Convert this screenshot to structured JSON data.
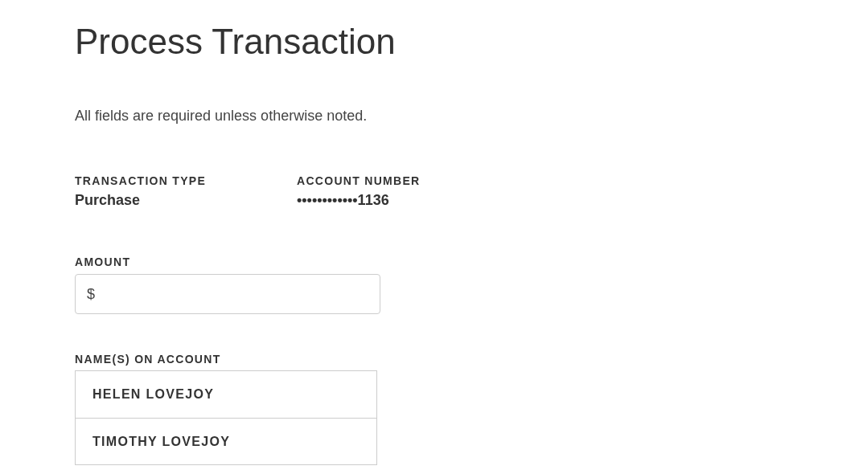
{
  "title": "Process Transaction",
  "instructions": "All fields are required unless otherwise noted.",
  "details": [
    {
      "label": "TRANSACTION TYPE",
      "value": "Purchase"
    },
    {
      "label": "ACCOUNT NUMBER",
      "value": "••••••••••••1136"
    }
  ],
  "amount": {
    "label": "AMOUNT",
    "prefix": "$"
  },
  "names": {
    "label": "NAME(S) ON ACCOUNT",
    "items": [
      "HELEN LOVEJOY",
      "TIMOTHY LOVEJOY"
    ]
  }
}
